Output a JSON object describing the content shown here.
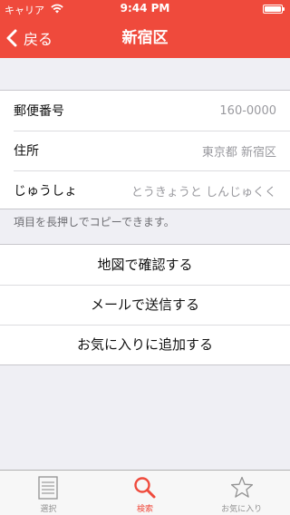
{
  "status": {
    "carrier": "キャリア",
    "time": "9:44 PM"
  },
  "nav": {
    "back_label": "戻る",
    "title": "新宿区"
  },
  "info": {
    "rows": [
      {
        "key": "郵便番号",
        "value": "160-0000"
      },
      {
        "key": "住所",
        "value": "東京都 新宿区"
      },
      {
        "key": "じゅうしょ",
        "value": "とうきょうと しんじゅくく"
      }
    ],
    "hint": "項目を長押しでコピーできます。"
  },
  "actions": [
    {
      "label": "地図で確認する"
    },
    {
      "label": "メールで送信する"
    },
    {
      "label": "お気に入りに追加する"
    }
  ],
  "tabs": [
    {
      "label": "選択",
      "icon": "list-icon"
    },
    {
      "label": "検索",
      "icon": "search-icon",
      "active": true
    },
    {
      "label": "お気に入り",
      "icon": "star-icon"
    }
  ],
  "colors": {
    "accent": "#ef4a3c",
    "background": "#efeff4"
  }
}
